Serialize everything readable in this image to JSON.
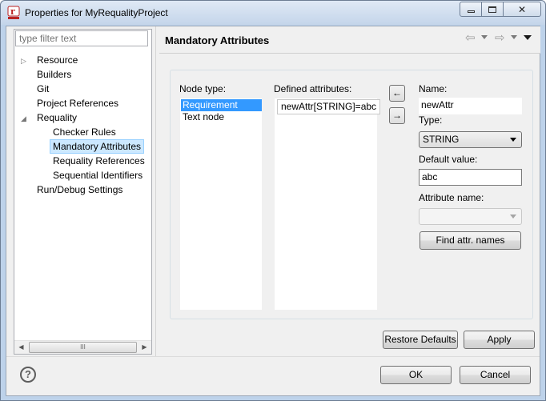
{
  "window": {
    "title": "Properties for MyRequalityProject",
    "minimize_glyph": "▭",
    "maximize_glyph": "□",
    "close_glyph": "✕"
  },
  "filter": {
    "placeholder": "type filter text"
  },
  "tree": {
    "items": [
      {
        "label": "Resource",
        "expandable": true
      },
      {
        "label": "Builders"
      },
      {
        "label": "Git"
      },
      {
        "label": "Project References"
      },
      {
        "label": "Requality",
        "expanded": true
      },
      {
        "label": "Checker Rules"
      },
      {
        "label": "Mandatory Attributes",
        "selected": true
      },
      {
        "label": "Requality References"
      },
      {
        "label": "Sequential Identifiers"
      },
      {
        "label": "Run/Debug Settings"
      }
    ],
    "scroll_grip": "III"
  },
  "page": {
    "title": "Mandatory Attributes",
    "nav_back_glyph": "⇦",
    "nav_forward_glyph": "⇨"
  },
  "node_type": {
    "label": "Node type:",
    "items": [
      "Requirement",
      "Text node"
    ],
    "selected": "Requirement"
  },
  "defined_attributes": {
    "label": "Defined attributes:",
    "items": [
      "newAttr[STRING]=abc"
    ]
  },
  "move_buttons": {
    "add": "←",
    "remove": "→"
  },
  "form": {
    "name_label": "Name:",
    "name_value": "newAttr",
    "type_label": "Type:",
    "type_value": "STRING",
    "default_label": "Default value:",
    "default_value": "abc",
    "attr_name_label": "Attribute name:",
    "attr_name_value": "",
    "find_button": "Find attr. names"
  },
  "buttons": {
    "restore_defaults": "Restore Defaults",
    "apply": "Apply",
    "ok": "OK",
    "cancel": "Cancel",
    "help": "?"
  },
  "colors": {
    "selection": "#3399ff",
    "tree_selection": "#cce8ff",
    "window_frame": "#bdd2ea"
  }
}
